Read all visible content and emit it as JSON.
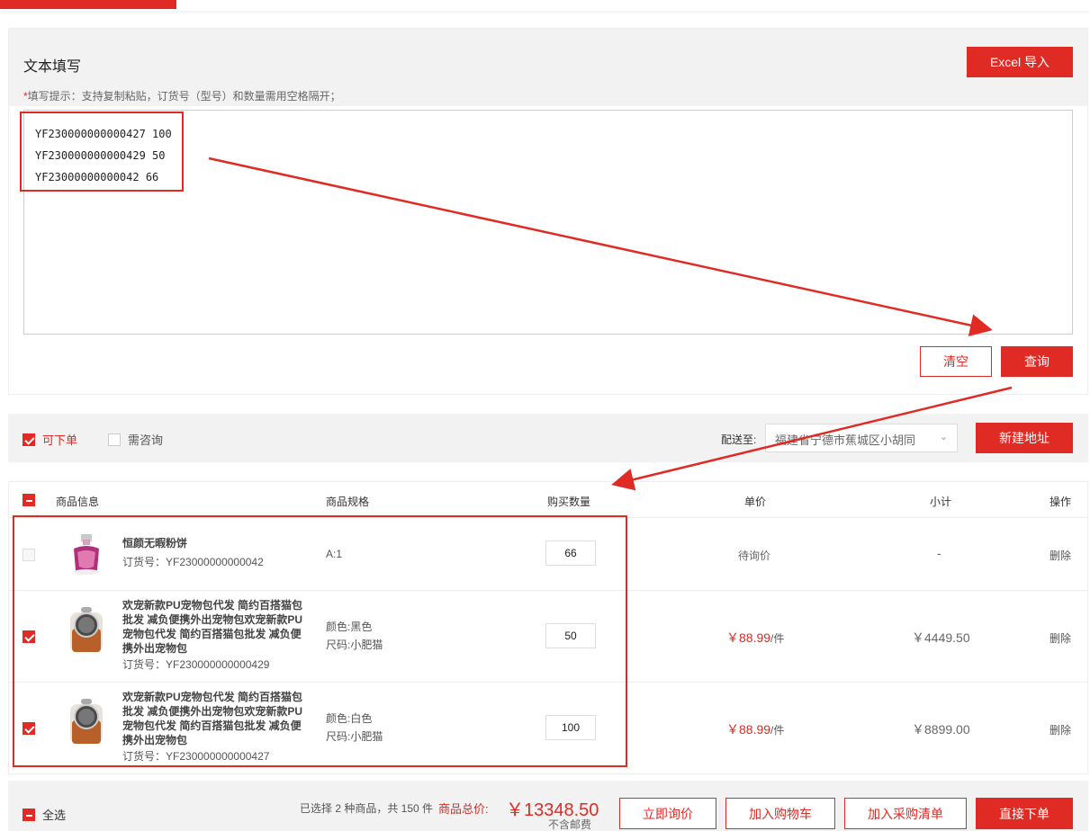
{
  "colors": {
    "accent": "#e02a24",
    "annotation": "#e02a24"
  },
  "text_panel": {
    "title": "文本填写",
    "excel_button": "Excel 导入",
    "tip_star": "*",
    "tip": "填写提示：支持复制粘贴，订货号（型号）和数量需用空格隔开；",
    "lines": [
      "YF230000000000427 100",
      "YF230000000000429 50",
      "YF23000000000042 66"
    ],
    "clear_button": "清空",
    "query_button": "查询"
  },
  "filter": {
    "orderable_label": "可下单",
    "orderable_checked": true,
    "consult_label": "需咨询",
    "consult_checked": false,
    "ship_label": "配送至:",
    "address": "福建省宁德市蕉城区小胡同",
    "new_address_button": "新建地址"
  },
  "table": {
    "headers": {
      "product": "商品信息",
      "spec": "商品规格",
      "qty": "购买数量",
      "price": "单价",
      "subtotal": "小计",
      "action": "操作"
    },
    "rows": [
      {
        "checked": false,
        "name": "恒颜无暇粉饼",
        "code_label": "订货号：",
        "code": "YF23000000000042",
        "spec1": "A:1",
        "spec2": "",
        "qty": "66",
        "price": "待询价",
        "subtotal": "-",
        "action": "删除",
        "image": "perfume-bottle-icon"
      },
      {
        "checked": true,
        "name": "欢宠新款PU宠物包代发 简约百搭猫包批发 减负便携外出宠物包欢宠新款PU宠物包代发 简约百搭猫包批发 减负便携外出宠物包",
        "code_label": "订货号：",
        "code": "YF230000000000429",
        "spec1": "颜色:黑色",
        "spec2": "尺码:小肥猫",
        "qty": "50",
        "price": "￥88.99",
        "price_unit": "/件",
        "subtotal": "￥4449.50",
        "action": "删除",
        "image": "pet-backpack-icon"
      },
      {
        "checked": true,
        "name": "欢宠新款PU宠物包代发 简约百搭猫包批发 减负便携外出宠物包欢宠新款PU宠物包代发 简约百搭猫包批发 减负便携外出宠物包",
        "code_label": "订货号：",
        "code": "YF230000000000427",
        "spec1": "颜色:白色",
        "spec2": "尺码:小肥猫",
        "qty": "100",
        "price": "￥88.99",
        "price_unit": "/件",
        "subtotal": "￥8899.00",
        "action": "删除",
        "image": "pet-backpack-icon"
      }
    ]
  },
  "footer": {
    "select_all": "全选",
    "summary": "已选择 2 种商品，共 150 件",
    "total_label": "商品总价:",
    "total": "￥13348.50",
    "no_shipping": "不含邮费",
    "buttons": {
      "inquiry": "立即询价",
      "add_cart": "加入购物车",
      "add_purchase": "加入采购清单",
      "order": "直接下单"
    }
  }
}
